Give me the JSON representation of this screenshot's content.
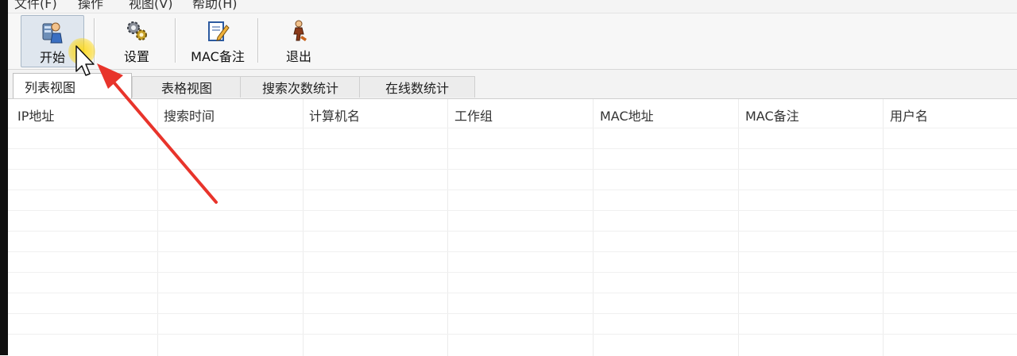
{
  "menubar": {
    "items": [
      "文件(F)",
      "操作",
      "视图(V)",
      "帮助(H)"
    ]
  },
  "toolbar": {
    "buttons": [
      {
        "label": "开始",
        "icon": "start-scan-icon"
      },
      {
        "label": "设置",
        "icon": "settings-gear-icon"
      },
      {
        "label": "MAC备注",
        "icon": "mac-note-icon"
      },
      {
        "label": "退出",
        "icon": "exit-icon"
      }
    ]
  },
  "tabs": {
    "active": "列表视图",
    "items": [
      "列表视图",
      "表格视图",
      "搜索次数统计",
      "在线数统计"
    ]
  },
  "table": {
    "columns": [
      "IP地址",
      "搜索时间",
      "计算机名",
      "工作组",
      "MAC地址",
      "MAC备注",
      "用户名"
    ],
    "rows": []
  },
  "colors": {
    "annotation_arrow": "#e8342b",
    "cursor_highlight": "#ffd600"
  }
}
